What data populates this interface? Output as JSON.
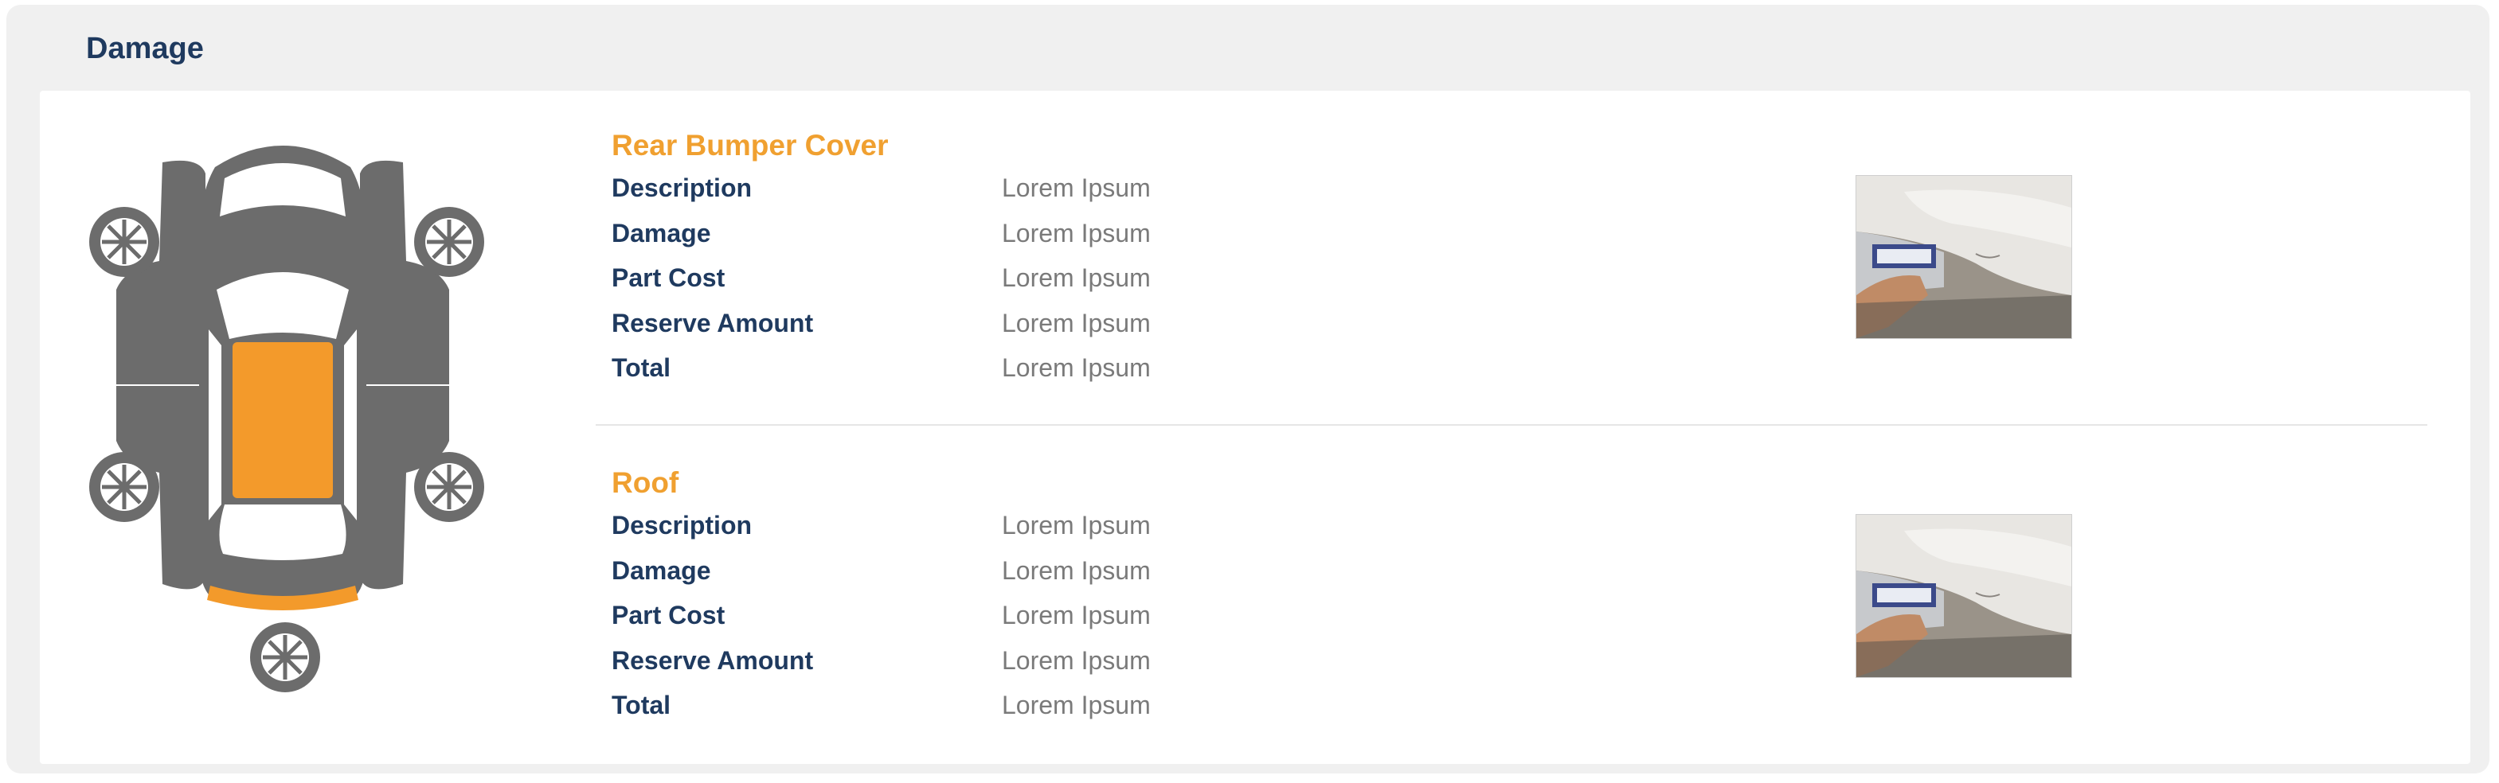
{
  "panel": {
    "title": "Damage"
  },
  "diagram": {
    "highlight_color": "#f39a2b",
    "body_color": "#6c6c6c",
    "highlighted_parts": [
      "roof",
      "rear-bumper"
    ]
  },
  "damages": [
    {
      "part": "Rear Bumper Cover",
      "fields": [
        {
          "label": "Description",
          "value": "Lorem Ipsum"
        },
        {
          "label": "Damage",
          "value": "Lorem Ipsum"
        },
        {
          "label": "Part Cost",
          "value": "Lorem Ipsum"
        },
        {
          "label": "Reserve Amount",
          "value": "Lorem Ipsum"
        },
        {
          "label": "Total",
          "value": "Lorem Ipsum"
        }
      ]
    },
    {
      "part": "Roof",
      "fields": [
        {
          "label": "Description",
          "value": "Lorem Ipsum"
        },
        {
          "label": "Damage",
          "value": "Lorem Ipsum"
        },
        {
          "label": "Part Cost",
          "value": "Lorem Ipsum"
        },
        {
          "label": "Reserve Amount",
          "value": "Lorem Ipsum"
        },
        {
          "label": "Total",
          "value": "Lorem Ipsum"
        }
      ]
    }
  ]
}
